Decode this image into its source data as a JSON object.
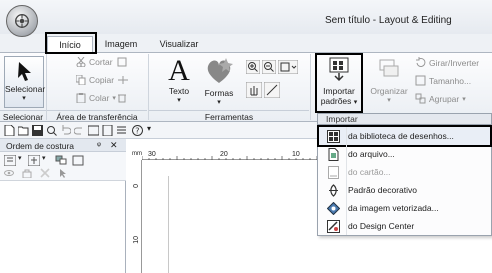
{
  "window": {
    "title": "Sem título - Layout & Editing"
  },
  "tabs": [
    {
      "label": "Início",
      "active": true
    },
    {
      "label": "Imagem",
      "active": false
    },
    {
      "label": "Visualizar",
      "active": false
    }
  ],
  "ribbon": {
    "selecionar": {
      "button": "Selecionar",
      "group": "Selecionar"
    },
    "clipboard": {
      "cortar": "Cortar",
      "copiar": "Copiar",
      "colar": "Colar",
      "group": "Área de transferência"
    },
    "ferramentas": {
      "texto": "Texto",
      "formas": "Formas",
      "group": "Ferramentas"
    },
    "importar": {
      "button_line1": "Importar",
      "button_line2": "padrões",
      "group": "Importar"
    },
    "organizar": {
      "organizar": "Organizar",
      "girar": "Girar/Inverter",
      "tamanho": "Tamanho...",
      "agrupar": "Agrupar"
    }
  },
  "left_panel": {
    "title": "Ordem de costura",
    "pin": "ᵠ",
    "close": "✕"
  },
  "ruler": {
    "h_labels": [
      "30",
      "20",
      "10"
    ],
    "v_labels": [
      "0",
      "10"
    ],
    "unit": "mm"
  },
  "import_menu": {
    "header": "Importar",
    "items": [
      {
        "label": "da biblioteca de desenhos...",
        "icon": "library-icon",
        "enabled": true
      },
      {
        "label": "do arquivo...",
        "icon": "file-icon",
        "enabled": true
      },
      {
        "label": "do cartão...",
        "icon": "card-icon",
        "enabled": false
      },
      {
        "label": "Padrão decorativo",
        "icon": "decorative-pattern-icon",
        "enabled": true
      },
      {
        "label": "da imagem vetorizada...",
        "icon": "vector-image-icon",
        "enabled": true
      },
      {
        "label": "do Design Center",
        "icon": "design-center-icon",
        "enabled": true
      }
    ]
  },
  "colors": {
    "highlight": "#000000",
    "ribbon_bg": "#eaeef3",
    "accent": "#2b6cb0"
  }
}
